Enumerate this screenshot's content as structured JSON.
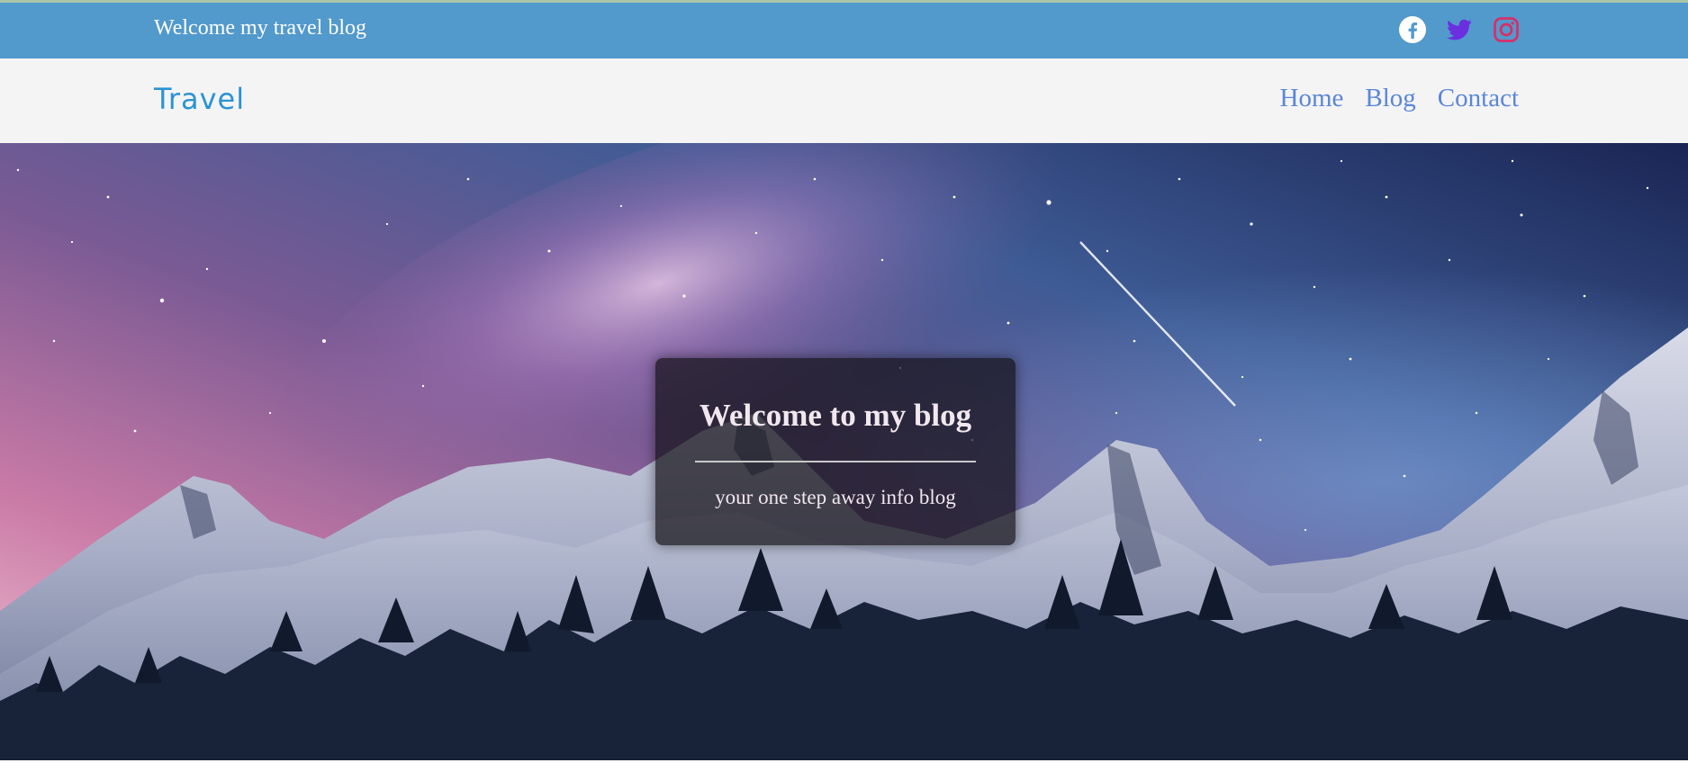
{
  "topbar": {
    "text": "Welcome my travel blog",
    "background": "#5299cc",
    "icons": [
      "facebook-icon",
      "twitter-icon",
      "instagram-icon"
    ]
  },
  "navbar": {
    "brand": "Travel",
    "links": [
      {
        "label": "Home"
      },
      {
        "label": "Blog"
      },
      {
        "label": "Contact"
      }
    ]
  },
  "hero": {
    "title": "Welcome to my blog",
    "subtitle": "your one step away info blog"
  },
  "colors": {
    "brand": "#2a93d5",
    "nav_link": "#5b86d6",
    "facebook": "#ffffff",
    "twitter": "#6b2fe0",
    "instagram": "#d6306a",
    "card_text": "#f1e7ee"
  }
}
